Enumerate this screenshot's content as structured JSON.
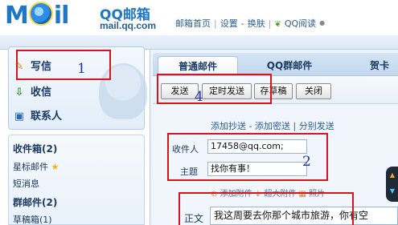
{
  "header": {
    "logo_text_left": "M",
    "logo_text_right": "il",
    "brand": "QQ邮箱",
    "domain": "mail.qq.com",
    "links": [
      {
        "label": "邮箱首页"
      },
      {
        "label": "设置"
      },
      {
        "label": "换肤"
      },
      {
        "label": "QQ阅读"
      }
    ],
    "sep_pipe": "|",
    "sep_dash": "-"
  },
  "sidebar": {
    "primary": [
      {
        "label": "写信",
        "icon": "pencil-icon"
      },
      {
        "label": "收信",
        "icon": "inbox-icon"
      },
      {
        "label": "联系人",
        "icon": "contacts-icon"
      }
    ],
    "folders": [
      {
        "label": "收件箱(2)"
      },
      {
        "label": "星标邮件"
      },
      {
        "label": "短消息"
      },
      {
        "label": "群邮件(2)"
      },
      {
        "label": "草稿箱(1)"
      }
    ]
  },
  "tabs": [
    {
      "label": "普通邮件",
      "active": true
    },
    {
      "label": "QQ群邮件",
      "active": false
    },
    {
      "label": "贺卡",
      "active": false
    }
  ],
  "toolbar": {
    "send": "发送",
    "scheduled_send": "定时发送",
    "save_draft": "存草稿",
    "close": "关闭"
  },
  "compose": {
    "add_cc": "添加抄送",
    "add_bcc": "添加密送",
    "separate_send": "分别发送",
    "link_sep": "-",
    "link_pipe": "|",
    "to_label": "收件人",
    "to_value": "17458@qq.com;",
    "subject_label": "主题",
    "subject_value": "找你有事！",
    "attach_label": "添加附件",
    "big_attach_label": "超大附件",
    "photo_label": "照片",
    "body_label": "正文",
    "body_value": "我这周要去你那个城市旅游，你有空"
  },
  "annotations": [
    "1",
    "2",
    "4"
  ],
  "colors": {
    "annotation_box": "#d8141c",
    "annotation_number": "#2233aa",
    "brand_blue": "#1e76c8"
  }
}
